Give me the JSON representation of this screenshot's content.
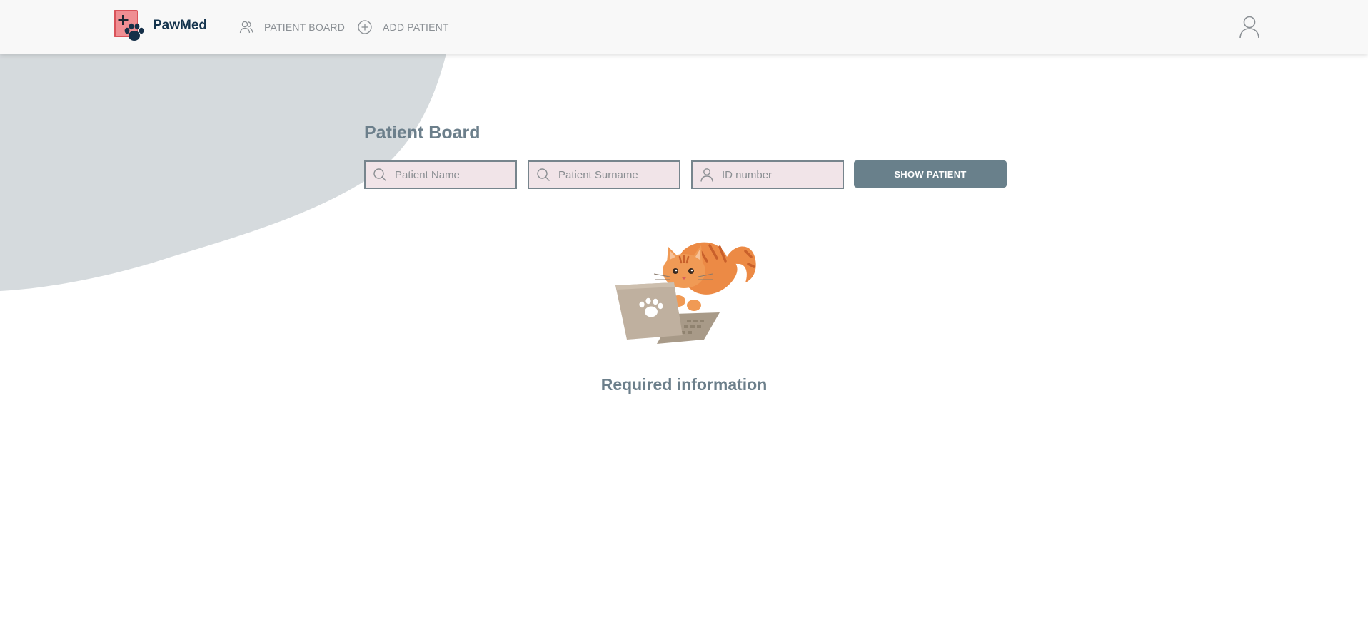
{
  "app": {
    "brand": "PawMed"
  },
  "nav": {
    "items": [
      {
        "label": "PATIENT BOARD",
        "icon": "users-icon"
      },
      {
        "label": "ADD PATIENT",
        "icon": "plus-circle-icon"
      }
    ]
  },
  "header": {
    "user_icon": "user-icon"
  },
  "main": {
    "title": "Patient Board",
    "search": {
      "name_placeholder": "Patient Name",
      "surname_placeholder": "Patient Surname",
      "id_placeholder": "ID number",
      "name_value": "",
      "surname_value": "",
      "id_value": ""
    },
    "show_button": "SHOW PATIENT",
    "message": "Required information"
  },
  "colors": {
    "accent": "#69808b",
    "title": "#6c7f8b",
    "brand": "#14344e",
    "input_bg": "#f1e4e8",
    "blob": "#d5dadd"
  }
}
